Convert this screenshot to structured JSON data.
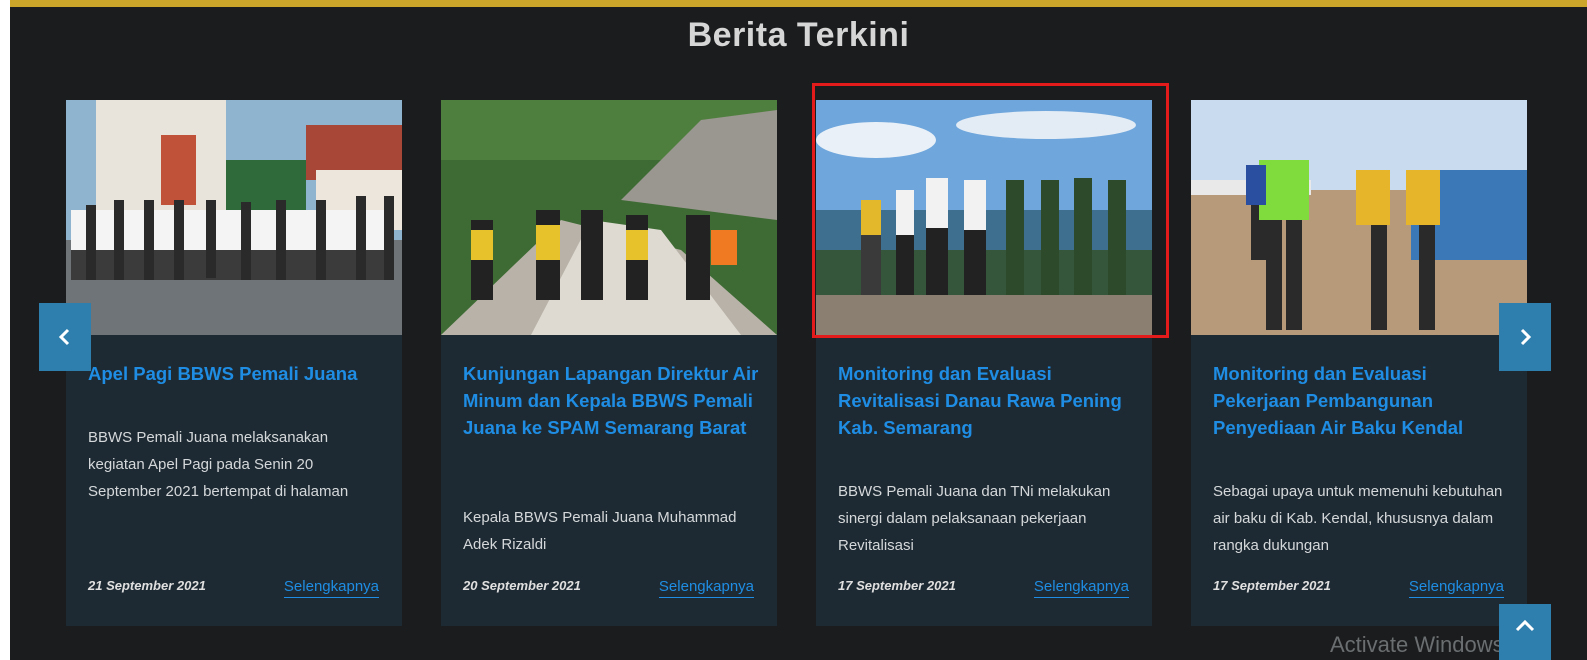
{
  "section": {
    "heading": "Berita Terkini"
  },
  "cards": [
    {
      "title": "Apel Pagi BBWS Pemali Juana",
      "excerpt": "BBWS Pemali Juana melaksanakan kegiatan Apel Pagi pada Senin 20 September 2021 bertempat di halaman parkir BBWS Pemali Juana. Kegiatan ini diikuti oleh para",
      "date": "21 September 2021",
      "more": "Selengkapnya"
    },
    {
      "title": "Kunjungan Lapangan Direktur Air Minum dan Kepala BBWS Pemali Juana ke SPAM Semarang Barat",
      "excerpt": "Kepala BBWS Pemali Juana Muhammad Adek Rizaldi",
      "date": "20 September 2021",
      "more": "Selengkapnya"
    },
    {
      "title": "Monitoring dan Evaluasi Revitalisasi Danau Rawa Pening Kab. Semarang",
      "excerpt": "BBWS Pemali Juana dan TNi melakukan sinergi dalam pelaksanaan pekerjaan Revitalisasi",
      "date": "17 September 2021",
      "more": "Selengkapnya"
    },
    {
      "title": "Monitoring dan Evaluasi Pekerjaan Pembangunan Penyediaan Air Baku Kendal",
      "excerpt": "Sebagai upaya untuk memenuhi kebutuhan air baku di Kab. Kendal, khususnya dalam rangka dukungan",
      "date": "17 September 2021",
      "more": "Selengkapnya"
    }
  ],
  "nav": {
    "prev_icon": "chevron-left-icon",
    "next_icon": "chevron-right-icon",
    "top_icon": "chevron-up-icon"
  },
  "watermark": "Activate Windows",
  "colors": {
    "accent": "#1e8de3",
    "nav_button": "#2f7fae",
    "highlight": "#e31b1b",
    "top_border": "#caa52a"
  }
}
